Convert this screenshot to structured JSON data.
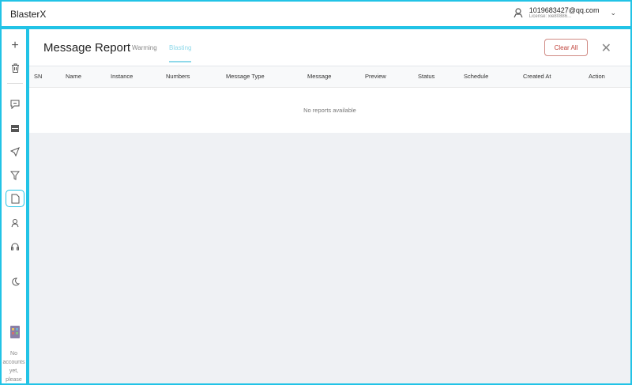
{
  "app": {
    "title": "BlasterX"
  },
  "user": {
    "email": "1019683427@qq.com",
    "license": "License: xie80886..."
  },
  "sidebar": {
    "no_accounts": "No accounts yet, please"
  },
  "page": {
    "title": "Message Report",
    "tabs": [
      {
        "label": "Warming"
      },
      {
        "label": "Blasting"
      }
    ],
    "clear_all": "Clear All",
    "close": "✕"
  },
  "table": {
    "columns": [
      "SN",
      "Name",
      "Instance",
      "Numbers",
      "Message Type",
      "Message",
      "Preview",
      "Status",
      "Schedule",
      "Created At",
      "Action"
    ],
    "empty": "No reports available"
  },
  "colors": {
    "accent": "#22c3e6",
    "danger": "#c0443c"
  }
}
